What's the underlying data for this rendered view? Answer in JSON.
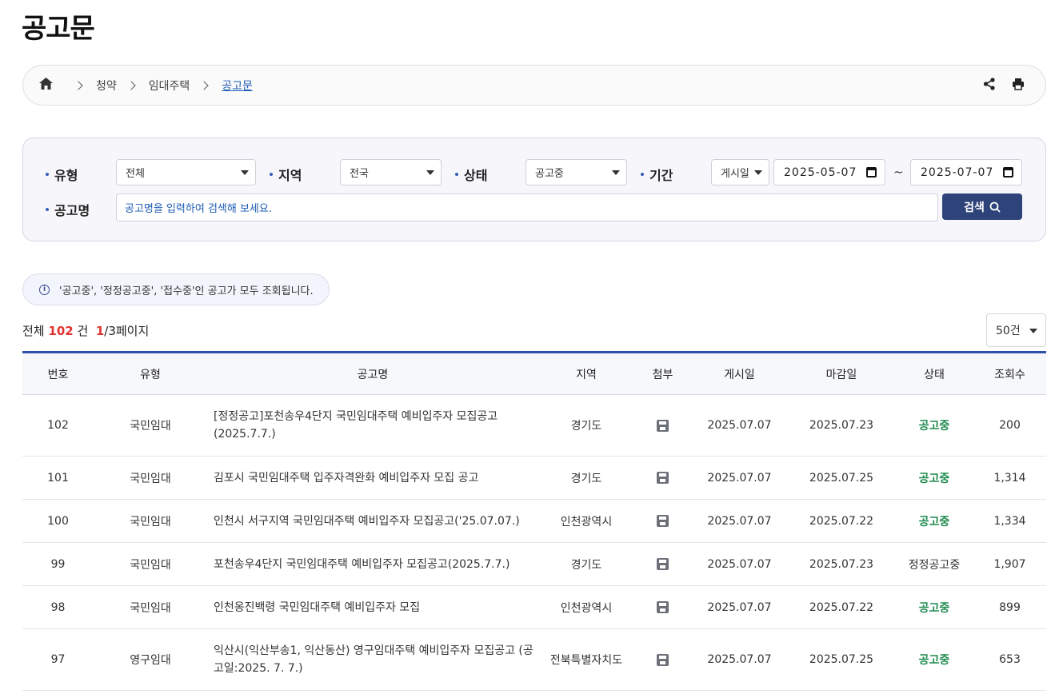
{
  "page": {
    "title": "공고문"
  },
  "breadcrumb": {
    "items": [
      "청약",
      "임대주택"
    ],
    "current": "공고문"
  },
  "search": {
    "type_label": "유형",
    "type_value": "전체",
    "region_label": "지역",
    "region_value": "전국",
    "status_label": "상태",
    "status_value": "공고중",
    "period_label": "기간",
    "period_type": "게시일",
    "date_from": "2025-05-07",
    "date_sep": "~",
    "date_to": "2025-07-07",
    "name_label": "공고명",
    "name_placeholder": "공고명을 입력하여 검색해 보세요.",
    "button_label": "검색"
  },
  "notice": {
    "text": "'공고중', '정정공고중', '접수중'인 공고가 모두 조회됩니다."
  },
  "summary": {
    "prefix": "전체",
    "total": "102",
    "unit": "건",
    "current_page": "1",
    "pages": "/3페이지"
  },
  "page_size": {
    "value": "50건"
  },
  "table": {
    "headers": [
      "번호",
      "유형",
      "공고명",
      "지역",
      "첨부",
      "게시일",
      "마감일",
      "상태",
      "조회수"
    ],
    "rows": [
      {
        "no": "102",
        "type": "국민임대",
        "title": "[정정공고]포천송우4단지 국민임대주택 예비입주자 모집공고 (2025.7.7.)",
        "region": "경기도",
        "posted": "2025.07.07",
        "deadline": "2025.07.23",
        "status": "공고중",
        "views": "200"
      },
      {
        "no": "101",
        "type": "국민임대",
        "title": "김포시 국민임대주택 입주자격완화 예비입주자 모집 공고",
        "region": "경기도",
        "posted": "2025.07.07",
        "deadline": "2025.07.25",
        "status": "공고중",
        "views": "1,314"
      },
      {
        "no": "100",
        "type": "국민임대",
        "title": "인천시 서구지역 국민임대주택 예비입주자 모집공고('25.07.07.)",
        "region": "인천광역시",
        "posted": "2025.07.07",
        "deadline": "2025.07.22",
        "status": "공고중",
        "views": "1,334"
      },
      {
        "no": "99",
        "type": "국민임대",
        "title": "포천송우4단지 국민임대주택 예비입주자 모집공고(2025.7.7.)",
        "region": "경기도",
        "posted": "2025.07.07",
        "deadline": "2025.07.23",
        "status": "정정공고중",
        "views": "1,907"
      },
      {
        "no": "98",
        "type": "국민임대",
        "title": "인천옹진백령 국민임대주택 예비입주자 모집",
        "region": "인천광역시",
        "posted": "2025.07.07",
        "deadline": "2025.07.22",
        "status": "공고중",
        "views": "899"
      },
      {
        "no": "97",
        "type": "영구임대",
        "title": "익산시(익산부송1, 익산동산) 영구임대주택 예비입주자 모집공고 (공고일:2025. 7. 7.)",
        "region": "전북특별자치도",
        "posted": "2025.07.07",
        "deadline": "2025.07.25",
        "status": "공고중",
        "views": "653"
      }
    ]
  }
}
